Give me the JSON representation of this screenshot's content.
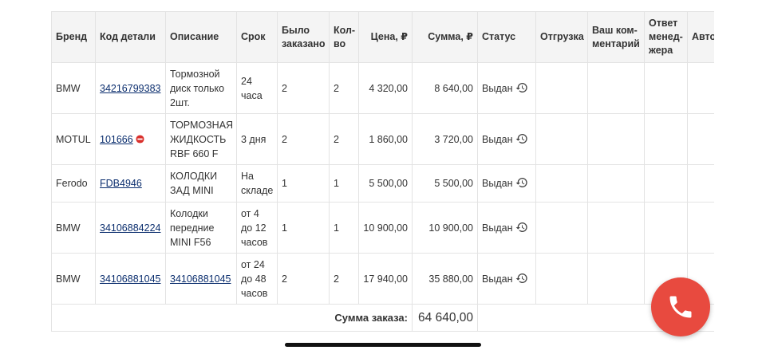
{
  "headers": {
    "brand": "Бренд",
    "part_code": "Код детали",
    "description": "Описание",
    "term": "Срок",
    "ordered_l1": "Было",
    "ordered_l2": "заказано",
    "qty_l1": "Кол-",
    "qty_l2": "во",
    "price": "Цена, ₽",
    "sum": "Сумма, ₽",
    "status": "Статус",
    "shipment": "Отгрузка",
    "comment_l1": "Ваш ком-",
    "comment_l2": "ментарий",
    "manager_l1": "Ответ",
    "manager_l2": "менед-",
    "manager_l3": "жера",
    "auto": "Авто"
  },
  "rows": [
    {
      "brand": "BMW",
      "code": "34216799383",
      "code_blocked": false,
      "desc": [
        "Тормозной",
        "диск только",
        "2шт."
      ],
      "term": [
        "24",
        "часа"
      ],
      "ordered": "2",
      "qty": "2",
      "price": "4 320,00",
      "sum": "8 640,00",
      "status": "Выдан"
    },
    {
      "brand": "MOTUL",
      "code": "101666",
      "code_blocked": true,
      "desc": [
        "ТОРМОЗНАЯ",
        "ЖИДКОСТЬ",
        "RBF 660 F"
      ],
      "term": [
        "3 дня"
      ],
      "ordered": "2",
      "qty": "2",
      "price": "1 860,00",
      "sum": "3 720,00",
      "status": "Выдан"
    },
    {
      "brand": "Ferodo",
      "code": "FDB4946",
      "code_blocked": false,
      "desc": [
        "КОЛОДКИ",
        "ЗАД MINI"
      ],
      "term": [
        "На",
        "складе"
      ],
      "ordered": "1",
      "qty": "1",
      "price": "5 500,00",
      "sum": "5 500,00",
      "status": "Выдан"
    },
    {
      "brand": "BMW",
      "code": "34106884224",
      "code_blocked": false,
      "desc": [
        "Колодки",
        "передние",
        "MINI F56"
      ],
      "term": [
        "от 4",
        "до 12",
        "часов"
      ],
      "ordered": "1",
      "qty": "1",
      "price": "10 900,00",
      "sum": "10 900,00",
      "status": "Выдан"
    },
    {
      "brand": "BMW",
      "code": "34106881045",
      "code_blocked": false,
      "desc": [
        "34106881045"
      ],
      "desc_is_link": true,
      "term": [
        "от 24",
        "до 48",
        "часов"
      ],
      "ordered": "2",
      "qty": "2",
      "price": "17 940,00",
      "sum": "35 880,00",
      "status": "Выдан"
    }
  ],
  "total": {
    "label": "Сумма заказа:",
    "value": "64 640,00"
  },
  "colors": {
    "accent_link": "#0b2e6e",
    "call_button": "#e84a3f",
    "header_bg": "#f4f4f4",
    "grid": "#e3e3e3"
  },
  "icons": {
    "status": "history-icon",
    "blocked": "no-entry-icon",
    "call": "phone-icon"
  }
}
